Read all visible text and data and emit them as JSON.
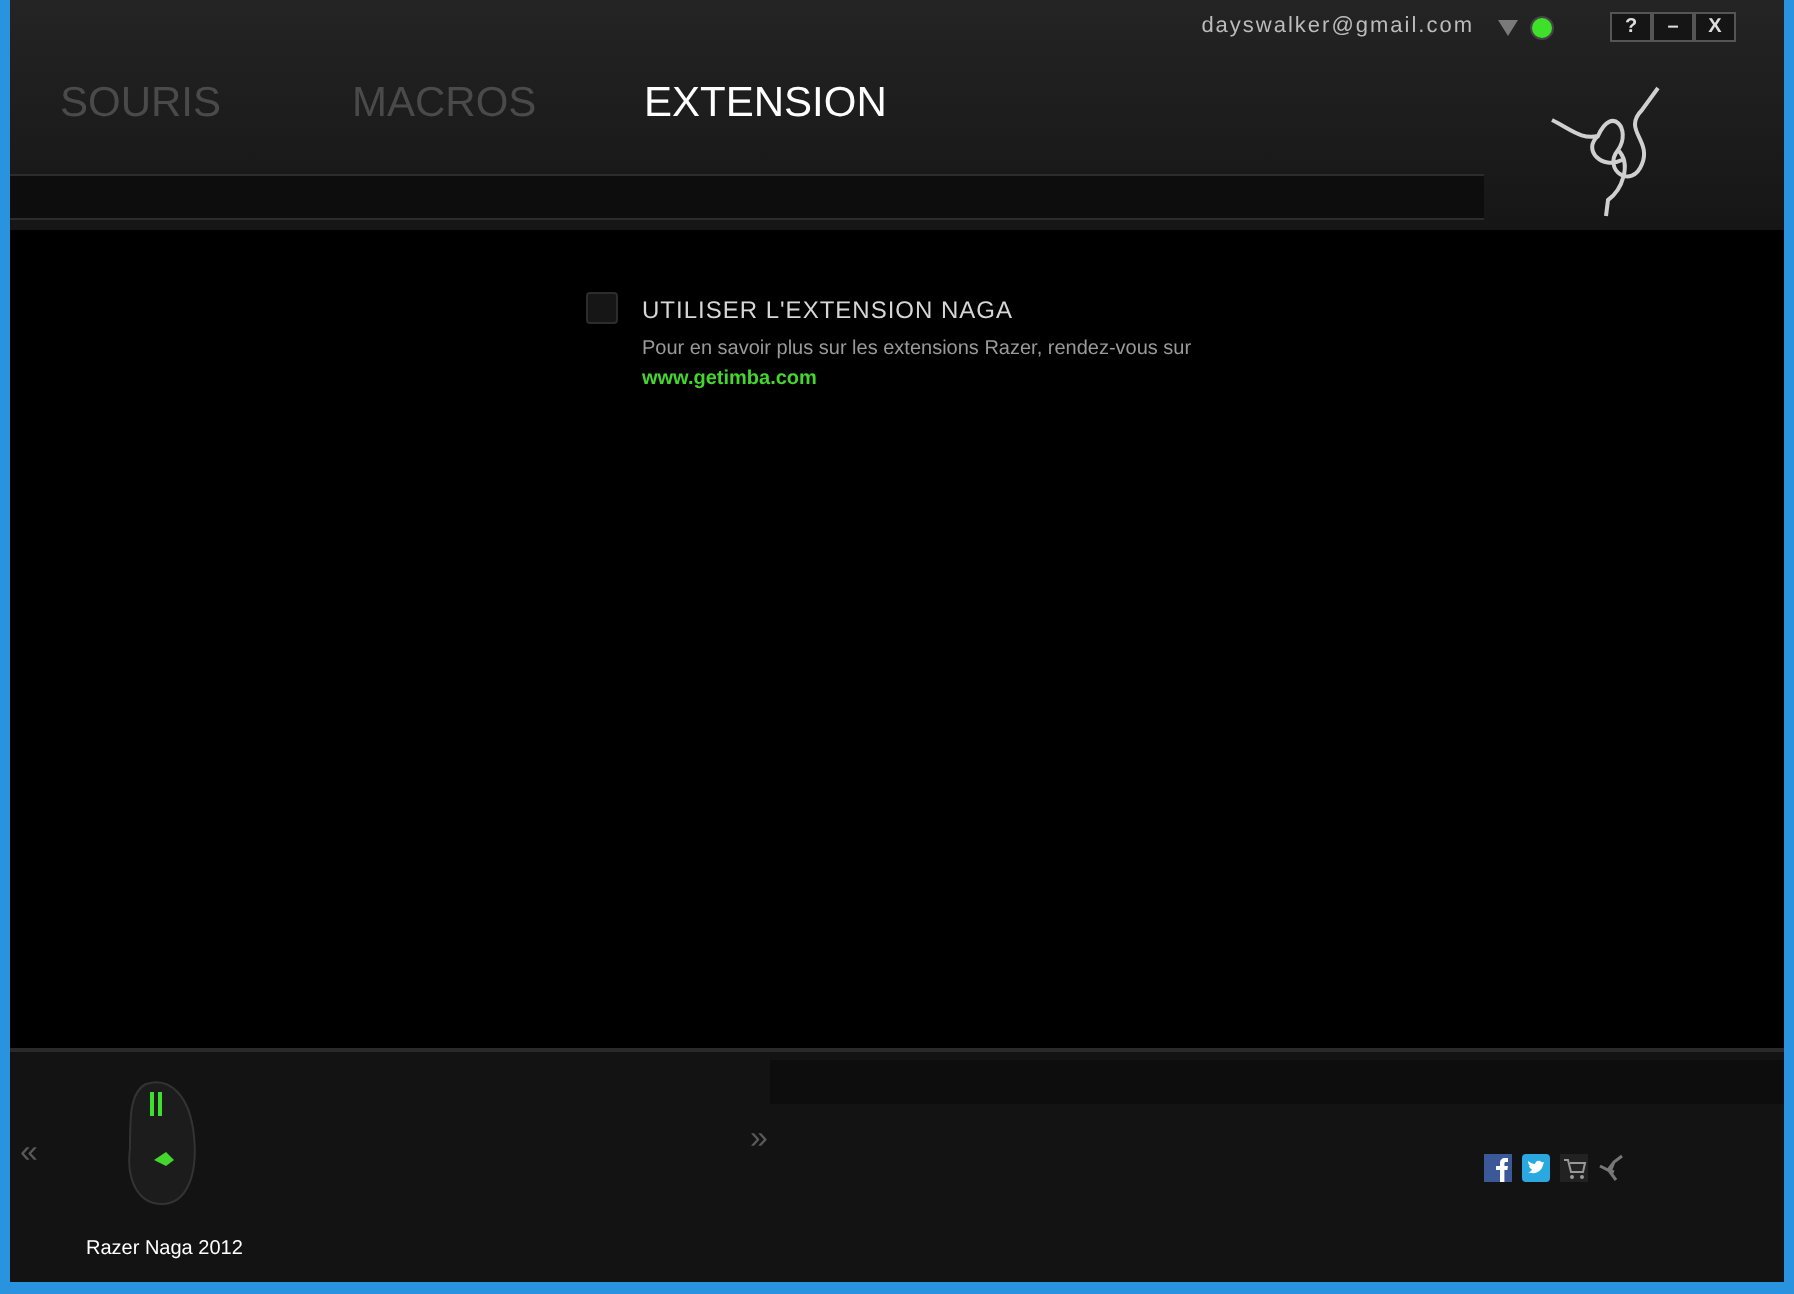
{
  "account": {
    "email": "dayswalker@gmail.com",
    "online": true
  },
  "window_buttons": [
    "?",
    "–",
    "X"
  ],
  "tabs": [
    {
      "label": "SOURIS",
      "selected": false
    },
    {
      "label": "MACROS",
      "selected": false
    },
    {
      "label": "EXTENSION",
      "selected": true
    }
  ],
  "extension": {
    "checked": false,
    "label": "UTILISER L'EXTENSION NAGA",
    "description": "Pour en savoir plus sur les extensions Razer, rendez-vous sur",
    "link": "www.getimba.com"
  },
  "device": {
    "prev": "«",
    "name": "Razer Naga 2012",
    "next": "»"
  }
}
